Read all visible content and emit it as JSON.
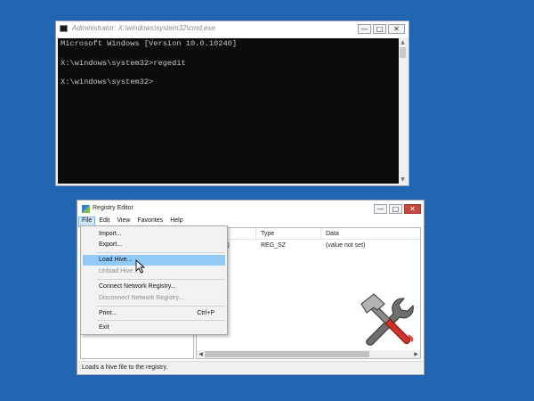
{
  "cmd": {
    "title": "Administrator: X:\\windows\\system32\\cmd.exe",
    "console_lines": [
      "Microsoft Windows [Version 10.0.10240]",
      "",
      "X:\\windows\\system32>regedit",
      "",
      "X:\\windows\\system32>"
    ],
    "buttons": {
      "minimize": "—",
      "maximize": "□",
      "close": "✕"
    }
  },
  "regedit": {
    "title": "Registry Editor",
    "menu": [
      "File",
      "Edit",
      "View",
      "Favorites",
      "Help"
    ],
    "columns": {
      "name_fragment": "",
      "type": "Type",
      "data": "Data"
    },
    "row": {
      "name_fragment": "lt)",
      "type": "REG_SZ",
      "data": "(value not set)"
    },
    "buttons": {
      "minimize": "—",
      "maximize": "□",
      "close": "✕"
    },
    "status": "Loads a hive file to the registry."
  },
  "file_menu": {
    "items": [
      {
        "label": "Import...",
        "enabled": true
      },
      {
        "label": "Export...",
        "enabled": true
      },
      {
        "label": "Load Hive...",
        "enabled": true,
        "hovered": true
      },
      {
        "label": "Unload Hive...",
        "enabled": false
      },
      {
        "label": "Connect Network Registry...",
        "enabled": true
      },
      {
        "label": "Disconnect Network Registry...",
        "enabled": false
      },
      {
        "label": "Print...",
        "enabled": true,
        "shortcut": "Ctrl+P"
      },
      {
        "label": "Exit",
        "enabled": true
      }
    ]
  },
  "colors": {
    "desktop": "#2166b3",
    "console_bg": "#0c0c0c",
    "console_text": "#c8c8c8",
    "menu_hover": "#91c9f7",
    "close_button": "#c7483e"
  },
  "icons": {
    "cmd": "cmd-app-icon",
    "regedit": "regedit-app-icon",
    "cursor": "mouse-pointer-icon",
    "logo": "hammer-wrench-icon"
  }
}
